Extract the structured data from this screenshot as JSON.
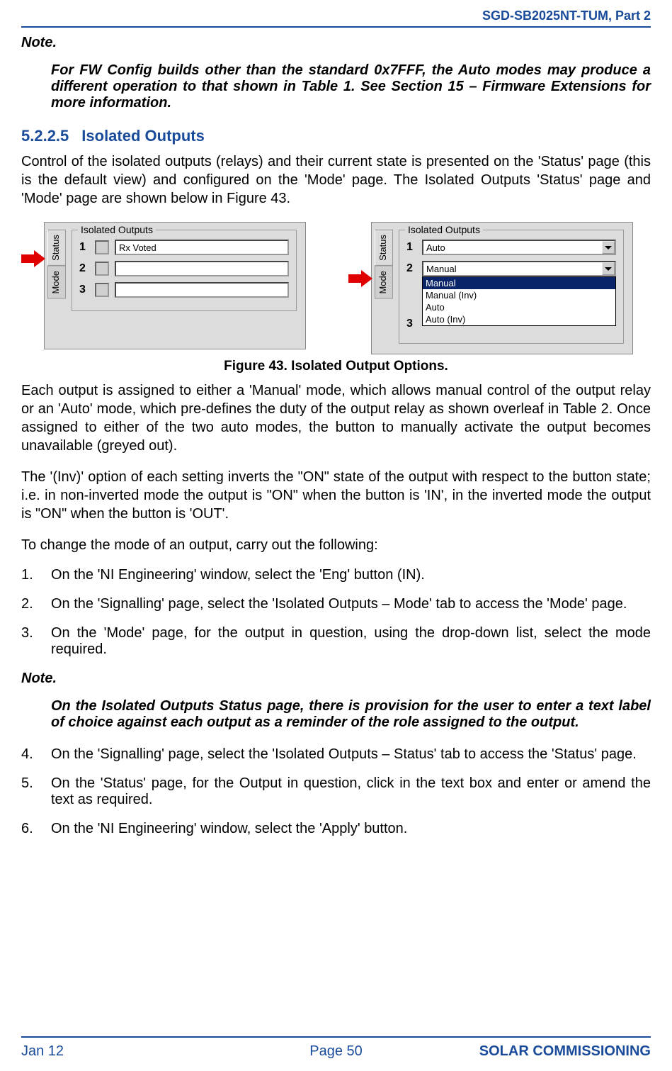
{
  "header": {
    "doc_id": "SGD-SB2025NT-TUM, Part 2"
  },
  "note1": {
    "label": "Note.",
    "body": "For FW Config builds other than the standard 0x7FFF, the Auto modes may produce a different operation to that shown in Table 1.  See Section 15 – Firmware Extensions for more information."
  },
  "section": {
    "number": "5.2.2.5",
    "title": "Isolated Outputs",
    "intro": "Control of the isolated outputs (relays) and their current state is presented on the 'Status' page (this is the default view) and configured on the 'Mode' page.   The Isolated Outputs 'Status' page and 'Mode' page are shown below in Figure 43."
  },
  "figure": {
    "caption": "Figure 43.  Isolated Output Options.",
    "group_title": "Isolated Outputs",
    "status_panel": {
      "tabs": {
        "active": "Status",
        "inactive": "Mode"
      },
      "rows": [
        {
          "num": "1",
          "value": "Rx Voted"
        },
        {
          "num": "2",
          "value": ""
        },
        {
          "num": "3",
          "value": ""
        }
      ]
    },
    "mode_panel": {
      "tabs": {
        "active": "Status",
        "inactive": "Mode"
      },
      "rows": [
        {
          "num": "1",
          "value": "Auto"
        },
        {
          "num": "2",
          "value": "Manual",
          "options": [
            "Manual",
            "Manual (Inv)",
            "Auto",
            "Auto (Inv)"
          ]
        },
        {
          "num": "3",
          "value": ""
        }
      ]
    }
  },
  "para1": "Each output is assigned to either a 'Manual' mode, which allows manual control of the output relay or an 'Auto' mode, which pre-defines the duty of the output relay as shown overleaf in Table 2. Once assigned to either of the two auto modes, the button to manually activate the output becomes unavailable (greyed out).",
  "para2": "The '(Inv)' option of each setting inverts the \"ON\" state of the output with respect to the button state; i.e. in non-inverted mode the output is \"ON\" when the button is 'IN', in the inverted mode the output is \"ON\" when the button is 'OUT'.",
  "para3": "To change the mode of an output, carry out the following:",
  "steps": {
    "s1": "On the 'NI Engineering' window, select the 'Eng' button (IN).",
    "s2": "On the 'Signalling' page, select the 'Isolated Outputs – Mode' tab to access the 'Mode' page.",
    "s3": "On the 'Mode' page, for the output in question, using the drop-down list, select the mode required.",
    "s4": "On the 'Signalling' page, select the 'Isolated Outputs – Status' tab to access the 'Status' page.",
    "s5": "On the 'Status' page, for the Output in question, click in the text box and enter or amend the text as required.",
    "s6": "On the 'NI Engineering' window, select the 'Apply' button."
  },
  "note2": {
    "label": "Note.",
    "body": "On the Isolated Outputs Status page, there is provision for the user to enter a text label of choice against each output as a reminder of the role assigned to the output."
  },
  "footer": {
    "left": "Jan 12",
    "center": "Page 50",
    "right": "SOLAR COMMISSIONING"
  }
}
